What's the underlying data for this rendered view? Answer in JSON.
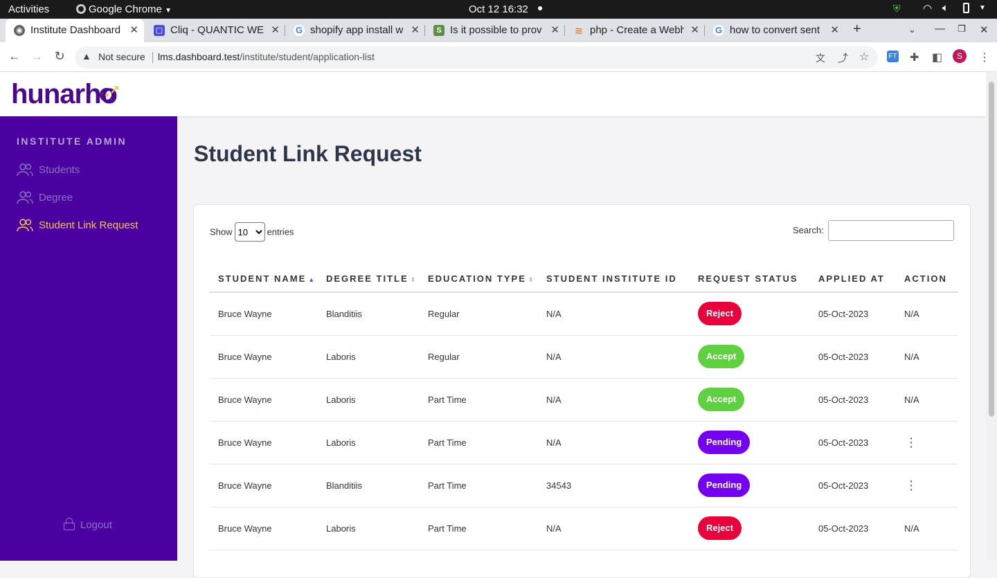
{
  "os_bar": {
    "activities": "Activities",
    "app_name": "Google Chrome",
    "clock": "Oct 12  16:32"
  },
  "tabs": [
    {
      "title": "Institute Dashboard",
      "favicon": "globe-icon",
      "color": "#5f6368",
      "active": true
    },
    {
      "title": "Cliq - QUANTIC WEB",
      "favicon": "cliq-icon",
      "color": "#4a4ad6"
    },
    {
      "title": "shopify app install w",
      "favicon": "google-icon",
      "color": "#4285f4"
    },
    {
      "title": "Is it possible to prov",
      "favicon": "shopify-icon",
      "color": "#5e8e3e"
    },
    {
      "title": "php - Create a Webh",
      "favicon": "stackoverflow-icon",
      "color": "#f48024"
    },
    {
      "title": "how to convert sent",
      "favicon": "google-icon",
      "color": "#4285f4"
    }
  ],
  "address": {
    "security": "Not secure",
    "host": "lms.dashboard.test",
    "path": "/institute/student/application-list"
  },
  "profile_initial": "S",
  "brand": {
    "logo_text": "hunarho",
    "color": "#4b0a8c",
    "accent": "#f5c84c"
  },
  "sidebar": {
    "heading": "INSTITUTE ADMIN",
    "items": [
      {
        "label": "Students",
        "active": false
      },
      {
        "label": "Degree",
        "active": false
      },
      {
        "label": "Student Link Request",
        "active": true
      }
    ],
    "logout": "Logout"
  },
  "page": {
    "title": "Student Link Request",
    "show_label": "Show",
    "entries_label": "entries",
    "page_size": "10",
    "search_label": "Search:",
    "search_value": ""
  },
  "table": {
    "columns": [
      "STUDENT NAME",
      "DEGREE TITLE",
      "EDUCATION TYPE",
      "STUDENT INSTITUTE ID",
      "REQUEST STATUS",
      "APPLIED AT",
      "ACTION"
    ],
    "rows": [
      {
        "name": "Bruce Wayne",
        "degree": "Blanditiis",
        "type": "Regular",
        "inst_id": "N/A",
        "status": "Reject",
        "applied": "05-Oct-2023",
        "action": "N/A"
      },
      {
        "name": "Bruce Wayne",
        "degree": "Laboris",
        "type": "Regular",
        "inst_id": "N/A",
        "status": "Accept",
        "applied": "05-Oct-2023",
        "action": "N/A"
      },
      {
        "name": "Bruce Wayne",
        "degree": "Laboris",
        "type": "Part Time",
        "inst_id": "N/A",
        "status": "Accept",
        "applied": "05-Oct-2023",
        "action": "N/A"
      },
      {
        "name": "Bruce Wayne",
        "degree": "Laboris",
        "type": "Part Time",
        "inst_id": "N/A",
        "status": "Pending",
        "applied": "05-Oct-2023",
        "action": "menu"
      },
      {
        "name": "Bruce Wayne",
        "degree": "Blanditiis",
        "type": "Part Time",
        "inst_id": "34543",
        "status": "Pending",
        "applied": "05-Oct-2023",
        "action": "menu"
      },
      {
        "name": "Bruce Wayne",
        "degree": "Laboris",
        "type": "Part Time",
        "inst_id": "N/A",
        "status": "Reject",
        "applied": "05-Oct-2023",
        "action": "N/A"
      }
    ]
  }
}
